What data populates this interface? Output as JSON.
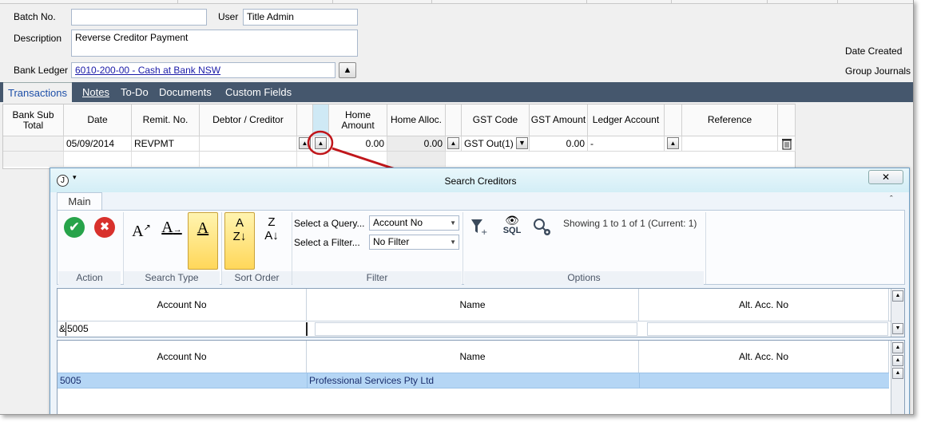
{
  "form": {
    "batch_label": "Batch No.",
    "batch_value": "",
    "user_label": "User",
    "user_value": "Title Admin",
    "description_label": "Description",
    "description_value": "Reverse Creditor Payment",
    "bank_ledger_label": "Bank Ledger",
    "bank_ledger_value": "6010-200-00 - Cash at Bank NSW",
    "date_created_label": "Date Created",
    "group_journals_label": "Group Journals"
  },
  "tabs": [
    "Transactions",
    "Notes",
    "To-Do",
    "Documents",
    "Custom Fields"
  ],
  "grid": {
    "headers": [
      "Bank Sub Total",
      "Date",
      "Remit. No.",
      "Debtor / Creditor",
      "Home Amount",
      "Home Alloc.",
      "GST Code",
      "GST Amount",
      "Ledger Account",
      "Reference"
    ],
    "row": {
      "date": "05/09/2014",
      "remit": "REVPMT",
      "debtor": "",
      "home_amount": "0.00",
      "home_alloc": "0.00",
      "gst_code": "GST Out(1)",
      "gst_amount": "0.00",
      "ledger": "-",
      "reference": ""
    }
  },
  "dialog": {
    "title": "Search Creditors",
    "ribbon_tab": "Main",
    "groups": {
      "action": "Action",
      "search_type": "Search Type",
      "sort_order": "Sort Order",
      "filter": "Filter",
      "options": "Options"
    },
    "query_label": "Select a Query...",
    "query_value": "Account No",
    "filter_label": "Select a Filter...",
    "filter_value": "No Filter",
    "sql_label": "SQL",
    "showing": "Showing 1 to 1 of 1 (Current: 1)",
    "search_headers": [
      "Account No",
      "Name",
      "Alt. Acc. No"
    ],
    "search_prefix": "&",
    "search_value": "5005",
    "results_headers": [
      "Account No",
      "Name",
      "Alt. Acc. No"
    ],
    "results": [
      {
        "account": "5005",
        "name": "Professional Services Pty Ltd",
        "alt": ""
      }
    ]
  },
  "colors": {
    "tabbar": "#45576d",
    "selection": "#b5d6f5",
    "annotation": "#c0161b"
  }
}
